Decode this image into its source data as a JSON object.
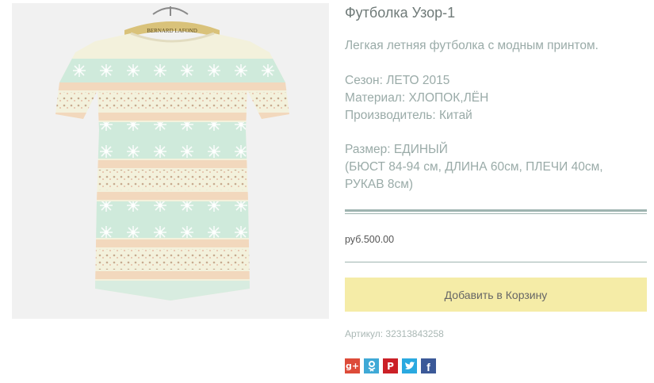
{
  "product": {
    "title": "Футболка Узор-1",
    "description": "Легкая летняя футболка с модным принтом.",
    "specs": {
      "season": "Сезон: ЛЕТО 2015",
      "material": "Материал: ХЛОПОК,ЛЁН",
      "manufacturer": "Производитель: Китай",
      "size": "Размер: ЕДИНЫЙ",
      "measurements_line1": "(БЮСТ 84-94 см, ДЛИНА 60см, ПЛЕЧИ 40см,",
      "measurements_line2": "РУКАВ 8см)"
    },
    "price": "руб.500.00",
    "add_to_cart_label": "Добавить в Корзину",
    "sku": "Артикул: 32313843258",
    "hanger_label": "BERNARD LAFOND"
  },
  "social": {
    "google_plus": {
      "icon": "google-plus-icon",
      "glyph": "g+",
      "color": "#dd4b39"
    },
    "odnoklassniki": {
      "icon": "odnoklassniki-icon",
      "color": "#3fa9d6"
    },
    "pinterest": {
      "icon": "pinterest-icon",
      "glyph": "P",
      "color": "#cb2027"
    },
    "twitter": {
      "icon": "twitter-icon",
      "color": "#2aa9e0"
    },
    "facebook": {
      "icon": "facebook-icon",
      "glyph": "f",
      "color": "#3b5998"
    }
  },
  "colors": {
    "accent_button": "#f5eca7",
    "rule": "#9fb4b0",
    "text_muted": "#9aaba8",
    "title": "#6f7a78"
  }
}
